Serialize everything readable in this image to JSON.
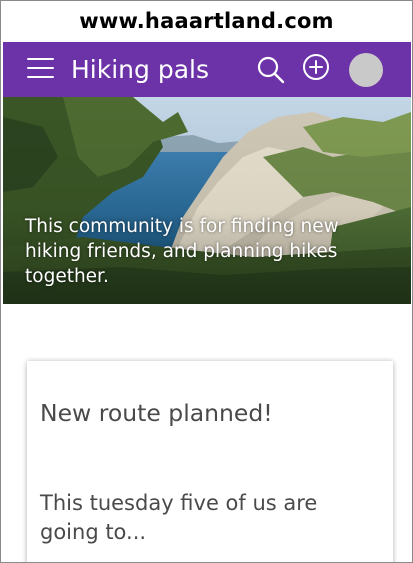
{
  "browser": {
    "url": "www.haaartland.com"
  },
  "app_bar": {
    "title": "Hiking pals",
    "color": "#6c32a8",
    "menu_icon": "hamburger-menu-icon",
    "search_icon": "search-icon",
    "add_icon": "add-circle-icon",
    "avatar_color": "#c9c9c9"
  },
  "hero": {
    "description": "This community is for finding new hiking friends, and planning hikes together."
  },
  "post_card": {
    "title": "New route planned!",
    "excerpt": "This tuesday five of us are going to..."
  }
}
